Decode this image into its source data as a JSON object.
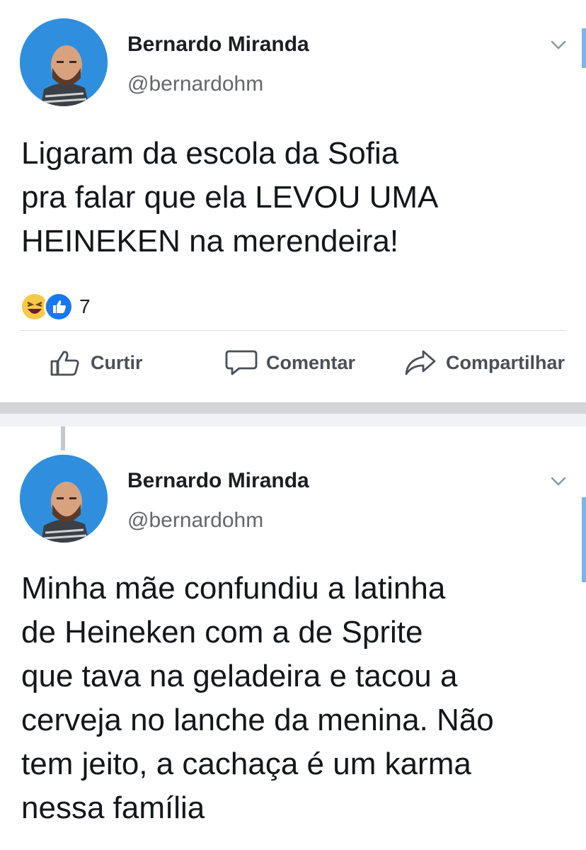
{
  "posts": [
    {
      "author_name": "Bernardo Miranda",
      "author_handle": "@bernardohm",
      "text": "Ligaram da escola da Sofia\npra falar que ela LEVOU UMA\nHEINEKEN na merendeira!",
      "reactions": {
        "icons": [
          "laughing-face-icon",
          "thumbs-up-icon"
        ],
        "count": "7"
      },
      "actions": {
        "like": "Curtir",
        "comment": "Comentar",
        "share": "Compartilhar"
      }
    },
    {
      "author_name": "Bernardo Miranda",
      "author_handle": "@bernardohm",
      "text": "Minha mãe confundiu a latinha\nde Heineken com a de Sprite\nque tava na geladeira e tacou a\ncerveja no lanche da menina. Não\ntem jeito, a cachaça é um karma\nnessa família"
    }
  ],
  "colors": {
    "avatar_bg": "#2f8fde",
    "name": "#1c1e21",
    "handle": "#65676b",
    "accent": "#7eb4e8",
    "separator": "#d3d5d8"
  }
}
